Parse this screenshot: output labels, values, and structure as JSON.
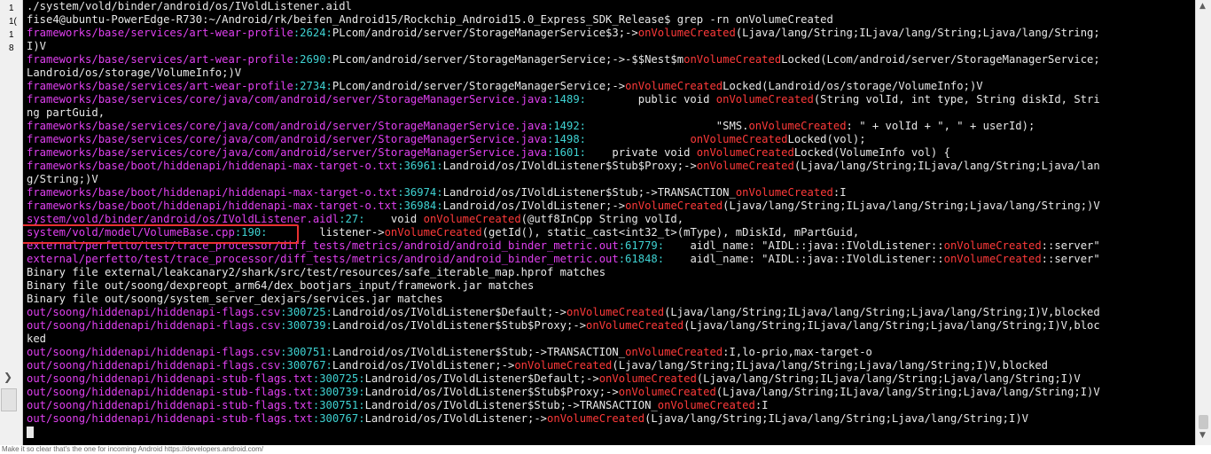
{
  "gutter": {
    "numbers": [
      "1",
      "1(",
      "1",
      "8"
    ]
  },
  "terminal": {
    "lines": [
      [
        {
          "t": "./system/vold/binder/android/os/IVoldListener.aidl"
        }
      ],
      [
        {
          "t": "fise4@ubuntu-PowerEdge-R730:~/Android/rk/beifen_Android15/Rockchip_Android15.0_Express_SDK_Release$ grep -rn onVolumeCreated"
        }
      ],
      [
        {
          "t": "frameworks/base/services/art-wear-profile",
          "c": "mg"
        },
        {
          "t": ":2624:",
          "c": "gr"
        },
        {
          "t": "PLcom/android/server/StorageManagerService$3;->"
        },
        {
          "t": "onVolumeCreated",
          "c": "rd"
        },
        {
          "t": "(Ljava/lang/String;ILjava/lang/String;Ljava/lang/String;"
        }
      ],
      [
        {
          "t": "I)V"
        }
      ],
      [
        {
          "t": "frameworks/base/services/art-wear-profile",
          "c": "mg"
        },
        {
          "t": ":2690:",
          "c": "gr"
        },
        {
          "t": "PLcom/android/server/StorageManagerService;->-$$Nest$m"
        },
        {
          "t": "onVolumeCreated",
          "c": "rd"
        },
        {
          "t": "Locked(Lcom/android/server/StorageManagerService;"
        }
      ],
      [
        {
          "t": "Landroid/os/storage/VolumeInfo;)V"
        }
      ],
      [
        {
          "t": "frameworks/base/services/art-wear-profile",
          "c": "mg"
        },
        {
          "t": ":2734:",
          "c": "gr"
        },
        {
          "t": "PLcom/android/server/StorageManagerService;->"
        },
        {
          "t": "onVolumeCreated",
          "c": "rd"
        },
        {
          "t": "Locked(Landroid/os/storage/VolumeInfo;)V"
        }
      ],
      [
        {
          "t": "frameworks/base/services/core/java/com/android/server/StorageManagerService.java",
          "c": "mg"
        },
        {
          "t": ":1489:",
          "c": "gr"
        },
        {
          "t": "        public void "
        },
        {
          "t": "onVolumeCreated",
          "c": "rd"
        },
        {
          "t": "(String volId, int type, String diskId, Stri"
        }
      ],
      [
        {
          "t": "ng partGuid,"
        }
      ],
      [
        {
          "t": "frameworks/base/services/core/java/com/android/server/StorageManagerService.java",
          "c": "mg"
        },
        {
          "t": ":1492:",
          "c": "gr"
        },
        {
          "t": "                    \"SMS."
        },
        {
          "t": "onVolumeCreated",
          "c": "rd"
        },
        {
          "t": ": \" + volId + \", \" + userId);"
        }
      ],
      [
        {
          "t": "frameworks/base/services/core/java/com/android/server/StorageManagerService.java",
          "c": "mg"
        },
        {
          "t": ":1498:",
          "c": "gr"
        },
        {
          "t": "                "
        },
        {
          "t": "onVolumeCreated",
          "c": "rd"
        },
        {
          "t": "Locked(vol);"
        }
      ],
      [
        {
          "t": "frameworks/base/services/core/java/com/android/server/StorageManagerService.java",
          "c": "mg"
        },
        {
          "t": ":1601:",
          "c": "gr"
        },
        {
          "t": "    private void "
        },
        {
          "t": "onVolumeCreated",
          "c": "rd"
        },
        {
          "t": "Locked(VolumeInfo vol) {"
        }
      ],
      [
        {
          "t": "frameworks/base/boot/hiddenapi/hiddenapi-max-target-o.txt",
          "c": "mg"
        },
        {
          "t": ":36961:",
          "c": "gr"
        },
        {
          "t": "Landroid/os/IVoldListener$Stub$Proxy;->"
        },
        {
          "t": "onVolumeCreated",
          "c": "rd"
        },
        {
          "t": "(Ljava/lang/String;ILjava/lang/String;Ljava/lan"
        }
      ],
      [
        {
          "t": "g/String;)V"
        }
      ],
      [
        {
          "t": "frameworks/base/boot/hiddenapi/hiddenapi-max-target-o.txt",
          "c": "mg"
        },
        {
          "t": ":36974:",
          "c": "gr"
        },
        {
          "t": "Landroid/os/IVoldListener$Stub;->TRANSACTION_"
        },
        {
          "t": "onVolumeCreated",
          "c": "rd"
        },
        {
          "t": ":I"
        }
      ],
      [
        {
          "t": "frameworks/base/boot/hiddenapi/hiddenapi-max-target-o.txt",
          "c": "mg"
        },
        {
          "t": ":36984:",
          "c": "gr"
        },
        {
          "t": "Landroid/os/IVoldListener;->"
        },
        {
          "t": "onVolumeCreated",
          "c": "rd"
        },
        {
          "t": "(Ljava/lang/String;ILjava/lang/String;Ljava/lang/String;)V"
        }
      ],
      [
        {
          "t": "system/vold/binder/android/os/IVoldListener.aidl",
          "c": "mg"
        },
        {
          "t": ":27:",
          "c": "gr"
        },
        {
          "t": "    void "
        },
        {
          "t": "onVolumeCreated",
          "c": "rd"
        },
        {
          "t": "(@utf8InCpp String volId,"
        }
      ],
      [
        {
          "t": "system/vold/model/VolumeBase.cpp",
          "c": "mg"
        },
        {
          "t": ":190:",
          "c": "gr"
        },
        {
          "t": "        listener->"
        },
        {
          "t": "onVolumeCreated",
          "c": "rd"
        },
        {
          "t": "(getId(), static_cast<int32_t>(mType), mDiskId, mPartGuid,"
        }
      ],
      [
        {
          "t": "external/perfetto/test/trace_processor/diff_tests/metrics/android/android_binder_metric.out",
          "c": "mg"
        },
        {
          "t": ":61779:",
          "c": "gr"
        },
        {
          "t": "    aidl_name: \"AIDL::java::IVoldListener::"
        },
        {
          "t": "onVolumeCreated",
          "c": "rd"
        },
        {
          "t": "::server\""
        }
      ],
      [
        {
          "t": "external/perfetto/test/trace_processor/diff_tests/metrics/android/android_binder_metric.out",
          "c": "mg"
        },
        {
          "t": ":61848:",
          "c": "gr"
        },
        {
          "t": "    aidl_name: \"AIDL::java::IVoldListener::"
        },
        {
          "t": "onVolumeCreated",
          "c": "rd"
        },
        {
          "t": "::server\""
        }
      ],
      [
        {
          "t": "Binary file external/leakcanary2/shark/src/test/resources/safe_iterable_map.hprof matches"
        }
      ],
      [
        {
          "t": "Binary file out/soong/dexpreopt_arm64/dex_bootjars_input/framework.jar matches"
        }
      ],
      [
        {
          "t": "Binary file out/soong/system_server_dexjars/services.jar matches"
        }
      ],
      [
        {
          "t": "out/soong/hiddenapi/hiddenapi-flags.csv",
          "c": "mg"
        },
        {
          "t": ":300725:",
          "c": "gr"
        },
        {
          "t": "Landroid/os/IVoldListener$Default;->"
        },
        {
          "t": "onVolumeCreated",
          "c": "rd"
        },
        {
          "t": "(Ljava/lang/String;ILjava/lang/String;Ljava/lang/String;I)V,blocked"
        }
      ],
      [
        {
          "t": "out/soong/hiddenapi/hiddenapi-flags.csv",
          "c": "mg"
        },
        {
          "t": ":300739:",
          "c": "gr"
        },
        {
          "t": "Landroid/os/IVoldListener$Stub$Proxy;->"
        },
        {
          "t": "onVolumeCreated",
          "c": "rd"
        },
        {
          "t": "(Ljava/lang/String;ILjava/lang/String;Ljava/lang/String;I)V,bloc"
        }
      ],
      [
        {
          "t": "ked"
        }
      ],
      [
        {
          "t": "out/soong/hiddenapi/hiddenapi-flags.csv",
          "c": "mg"
        },
        {
          "t": ":300751:",
          "c": "gr"
        },
        {
          "t": "Landroid/os/IVoldListener$Stub;->TRANSACTION_"
        },
        {
          "t": "onVolumeCreated",
          "c": "rd"
        },
        {
          "t": ":I,lo-prio,max-target-o"
        }
      ],
      [
        {
          "t": "out/soong/hiddenapi/hiddenapi-flags.csv",
          "c": "mg"
        },
        {
          "t": ":300767:",
          "c": "gr"
        },
        {
          "t": "Landroid/os/IVoldListener;->"
        },
        {
          "t": "onVolumeCreated",
          "c": "rd"
        },
        {
          "t": "(Ljava/lang/String;ILjava/lang/String;Ljava/lang/String;I)V,blocked"
        }
      ],
      [
        {
          "t": "out/soong/hiddenapi/hiddenapi-stub-flags.txt",
          "c": "mg"
        },
        {
          "t": ":300725:",
          "c": "gr"
        },
        {
          "t": "Landroid/os/IVoldListener$Default;->"
        },
        {
          "t": "onVolumeCreated",
          "c": "rd"
        },
        {
          "t": "(Ljava/lang/String;ILjava/lang/String;Ljava/lang/String;I)V"
        }
      ],
      [
        {
          "t": "out/soong/hiddenapi/hiddenapi-stub-flags.txt",
          "c": "mg"
        },
        {
          "t": ":300739:",
          "c": "gr"
        },
        {
          "t": "Landroid/os/IVoldListener$Stub$Proxy;->"
        },
        {
          "t": "onVolumeCreated",
          "c": "rd"
        },
        {
          "t": "(Ljava/lang/String;ILjava/lang/String;Ljava/lang/String;I)V"
        }
      ],
      [
        {
          "t": "out/soong/hiddenapi/hiddenapi-stub-flags.txt",
          "c": "mg"
        },
        {
          "t": ":300751:",
          "c": "gr"
        },
        {
          "t": "Landroid/os/IVoldListener$Stub;->TRANSACTION_"
        },
        {
          "t": "onVolumeCreated",
          "c": "rd"
        },
        {
          "t": ":I"
        }
      ],
      [
        {
          "t": "out/soong/hiddenapi/hiddenapi-stub-flags.txt",
          "c": "mg"
        },
        {
          "t": ":300767:",
          "c": "gr"
        },
        {
          "t": "Landroid/os/IVoldListener;->"
        },
        {
          "t": "onVolumeCreated",
          "c": "rd"
        },
        {
          "t": "(Ljava/lang/String;ILjava/lang/String;Ljava/lang/String;I)V"
        }
      ]
    ]
  },
  "status": {
    "text": "Make it so clear that's the one for incoming Android  https://developers.android.com/"
  },
  "colors": {
    "terminal_bg": "#000000",
    "text": "#e8e8e8",
    "path": "#e040f0",
    "match": "#ff3a3a",
    "line_number": "#3fd2d2",
    "highlight_box": "#e83030"
  }
}
